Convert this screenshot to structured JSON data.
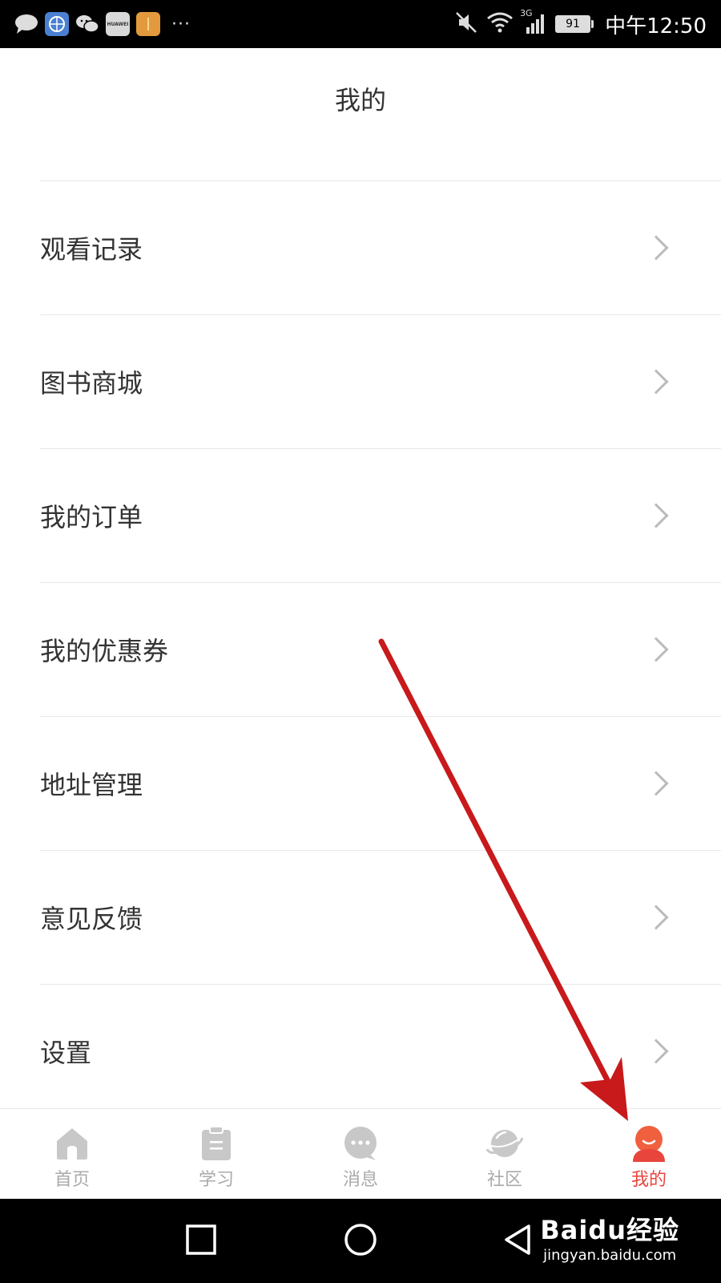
{
  "status_bar": {
    "notification_icons": [
      "message-icon",
      "browser-icon",
      "wechat-icon",
      "huawei-icon",
      "orange-app-icon"
    ],
    "huawei_label": "HUAWEI",
    "more": "···",
    "battery_level": "91",
    "time": "中午12:50",
    "network": "3G"
  },
  "header": {
    "title": "我的"
  },
  "menu": {
    "items": [
      {
        "label": "观看记录"
      },
      {
        "label": "图书商城"
      },
      {
        "label": "我的订单"
      },
      {
        "label": "我的优惠券"
      },
      {
        "label": "地址管理"
      },
      {
        "label": "意见反馈"
      },
      {
        "label": "设置"
      }
    ]
  },
  "tab_bar": {
    "active_color": "#e8453c",
    "inactive_color": "#aaaaaa",
    "tabs": [
      {
        "label": "首页",
        "icon": "home-icon"
      },
      {
        "label": "学习",
        "icon": "clipboard-icon"
      },
      {
        "label": "消息",
        "icon": "chat-bubble-icon"
      },
      {
        "label": "社区",
        "icon": "planet-icon"
      },
      {
        "label": "我的",
        "icon": "user-icon",
        "active": true
      }
    ]
  },
  "watermark": {
    "brand": "Baidu经验",
    "url": "jingyan.baidu.com"
  }
}
